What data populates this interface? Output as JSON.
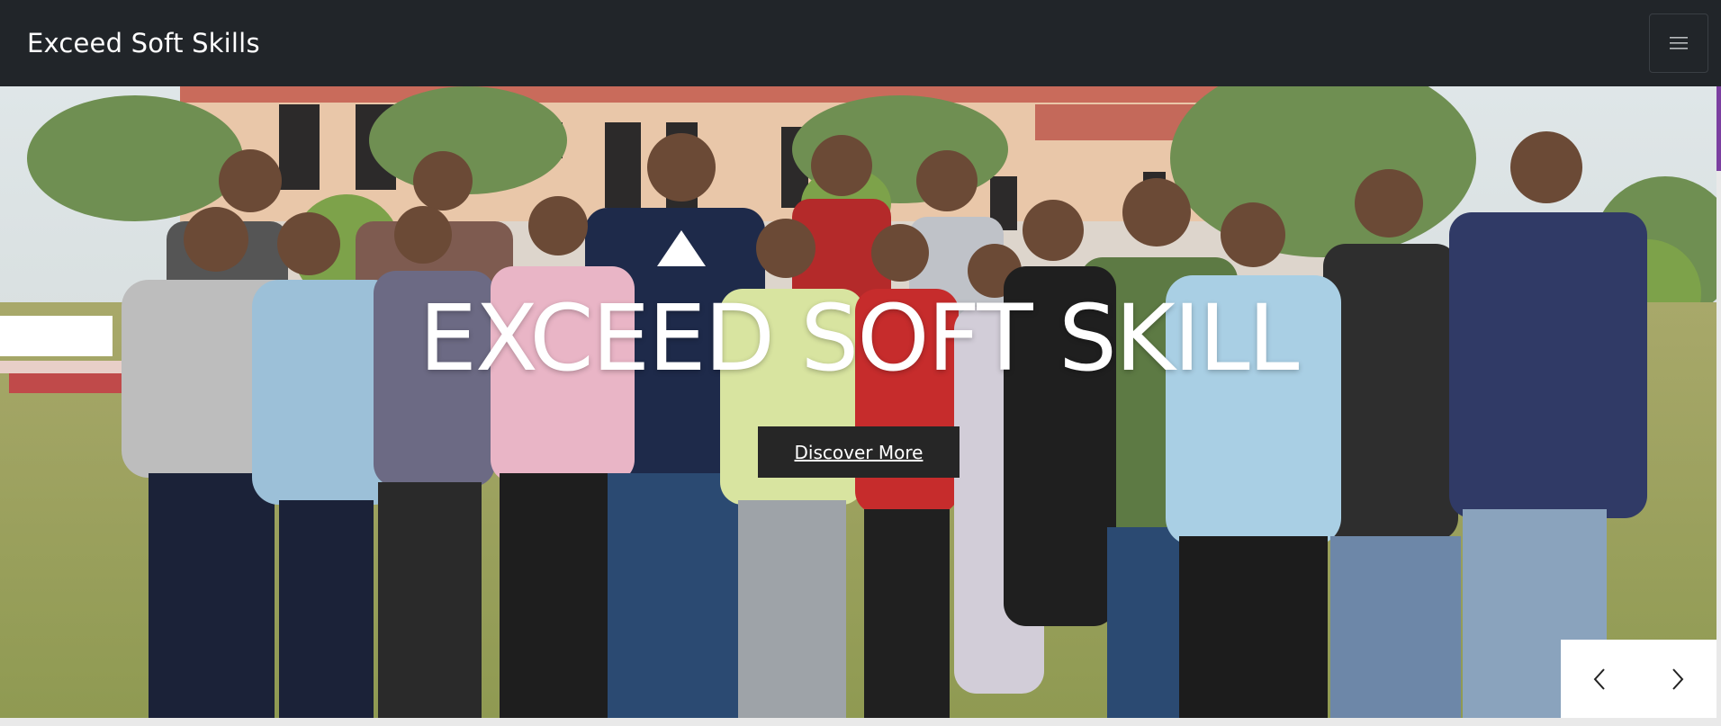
{
  "navbar": {
    "brand": "Exceed Soft Skills",
    "toggler_icon": "hamburger-menu-icon",
    "background": "#212529"
  },
  "hero": {
    "title": "EXCEED SOFT SKILL",
    "cta_label": "Discover More",
    "photo_description_icon": "group-photo",
    "prev_icon": "chevron-left-icon",
    "next_icon": "chevron-right-icon"
  },
  "colors": {
    "accent": "#7b3fa0",
    "button_bg": "#262626",
    "text_light": "#ffffff"
  }
}
